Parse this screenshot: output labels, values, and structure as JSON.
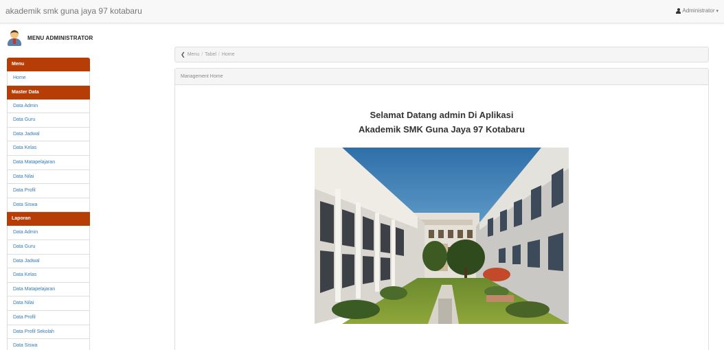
{
  "app": {
    "title": "akademik smk guna jaya 97 kotabaru",
    "user_label": "Administrator"
  },
  "sidebar": {
    "admin_title": "MENU ADMINISTRATOR",
    "menu_header": "Menu",
    "menu_items": [
      "Home"
    ],
    "master_header": "Master Data",
    "master_items": [
      "Data Admin",
      "Data Guru",
      "Data Jadwal",
      "Data Kelas",
      "Data Matapelajaran",
      "Data Nilai",
      "Data Profil",
      "Data Siswa"
    ],
    "laporan_header": "Laporan",
    "laporan_items": [
      "Data Admin",
      "Data Guru",
      "Data Jadwal",
      "Data Kelas",
      "Data Matapelajaran",
      "Data Nilai",
      "Data Profil",
      "Data Profil Sekolah",
      "Data Siswa"
    ]
  },
  "breadcrumb": {
    "items": [
      "Menu",
      "Tabel",
      "Home"
    ],
    "separator": "/"
  },
  "panel": {
    "heading": "Management Home",
    "welcome_line1": "Selamat Datang admin Di Aplikasi",
    "welcome_line2": "Akademik SMK Guna Jaya 97 Kotabaru"
  },
  "colors": {
    "accent": "#b63e06",
    "link": "#337ab7"
  },
  "icons": {
    "user": "user-icon",
    "caret": "caret-down-icon",
    "breadcrumb": "chevron-left-icon"
  }
}
